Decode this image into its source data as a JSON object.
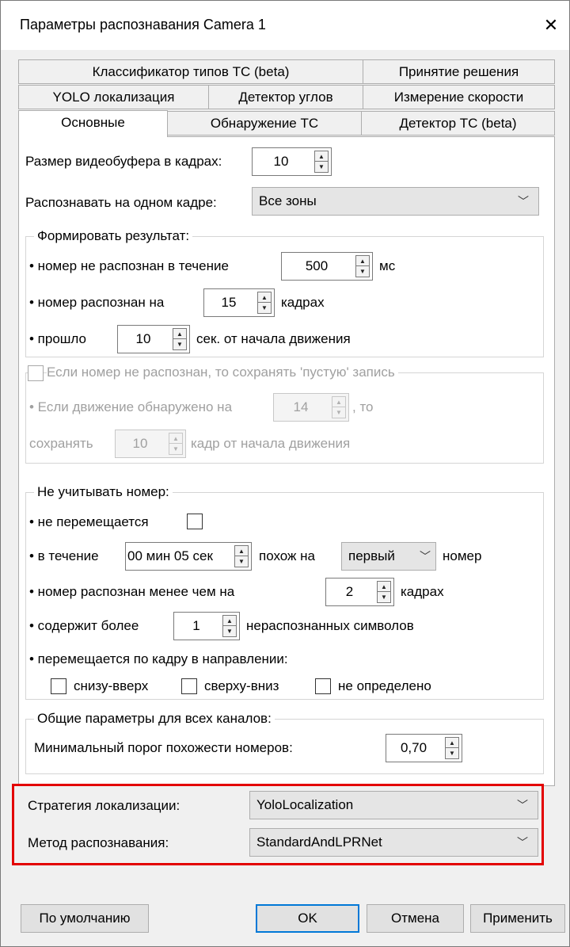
{
  "window": {
    "title": "Параметры распознавания Camera 1",
    "close_glyph": "✕"
  },
  "tabs": {
    "row1": [
      "Классификатор типов ТС (beta)",
      "Принятие решения"
    ],
    "row2": [
      "YOLO локализация",
      "Детектор углов",
      "Измерение скорости"
    ],
    "row3": [
      "Основные",
      "Обнаружение ТС",
      "Детектор ТС (beta)"
    ],
    "active": "Основные"
  },
  "main": {
    "buffer_label": "Размер видеобуфера в кадрах:",
    "buffer_value": "10",
    "one_frame_label": "Распознавать на одном кадре:",
    "one_frame_value": "Все зоны",
    "result": {
      "title": "Формировать результат:",
      "not_recognized_label": "• номер не распознан в течение",
      "not_recognized_value": "500",
      "not_recognized_unit": "мс",
      "recognized_on_label": "• номер распознан на",
      "recognized_on_value": "15",
      "recognized_on_unit": "кадрах",
      "passed_label": "• прошло",
      "passed_value": "10",
      "passed_unit": "сек. от начала движения"
    },
    "empty": {
      "checkbox_label": "Если номер не распознан, то сохранять 'пустую' запись",
      "motion_label": "• Если движение обнаружено на",
      "motion_value": "14",
      "motion_suffix": ", то",
      "save_label": "сохранять",
      "save_value": "10",
      "save_suffix": "кадр от начала движения"
    },
    "ignore": {
      "title": "Не учитывать номер:",
      "not_moving_label": "• не перемещается",
      "during_label": "• в течение",
      "during_value": "00 мин 05 сек",
      "similar_label": "похож на",
      "similar_value": "первый",
      "number_label": "номер",
      "less_than_label": "• номер распознан менее чем на",
      "less_than_value": "2",
      "less_than_unit": "кадрах",
      "contains_label": "• содержит более",
      "contains_value": "1",
      "contains_unit": "нераспознанных символов",
      "direction_label": "• перемещается по кадру в направлении:",
      "dir_up": "снизу-вверх",
      "dir_down": "сверху-вниз",
      "dir_undefined": "не определено"
    },
    "common": {
      "title": "Общие параметры для всех каналов:",
      "threshold_label": "Минимальный порог похожести номеров:",
      "threshold_value": "0,70"
    },
    "localization_label": "Стратегия локализации:",
    "localization_value": "YoloLocalization",
    "method_label": "Метод распознавания:",
    "method_value": "StandardAndLPRNet"
  },
  "buttons": {
    "defaults": "По умолчанию",
    "ok": "OK",
    "cancel": "Отмена",
    "apply": "Применить"
  },
  "colors": {
    "highlight": "#e30000",
    "focus": "#0078d7"
  }
}
